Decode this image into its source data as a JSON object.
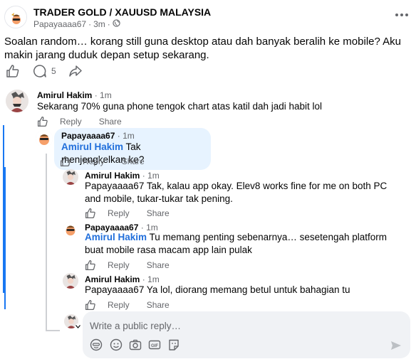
{
  "post": {
    "group_name": "TRADER GOLD / XAUUSD MALAYSIA",
    "author": "Papayaaaa67",
    "time": "3m",
    "separator": "·",
    "body": "Soalan random… korang still guna desktop atau dah banyak beralih ke mobile? Aku makin jarang duduk depan setup sekarang.",
    "comment_count": "5",
    "icons": [
      "like-icon",
      "comment-icon",
      "share-icon",
      "globe-icon",
      "more-options-icon"
    ]
  },
  "comments": [
    {
      "author": "Amirul Hakim",
      "time": "· 1m",
      "mention": "",
      "text": "Sekarang 70% guna phone tengok chart atas katil dah jadi habit lol",
      "reply_label": "Reply",
      "share_label": "Share"
    },
    {
      "author": "Papayaaaa67",
      "time": "· 1m",
      "mention": "Amirul Hakim",
      "text": "Tak menjengkelkan ke?",
      "reply_label": "Reply",
      "share_label": "Share"
    },
    {
      "author": "Amirul Hakim",
      "time": "· 1m",
      "mention": "",
      "text": "Papayaaaa67 Tak, kalau app okay. Elev8 works fine for me on both PC and mobile, tukar-tukar tak pening.",
      "reply_label": "Reply",
      "share_label": "Share"
    },
    {
      "author": "Papayaaaa67",
      "time": "· 1m",
      "mention": "Amirul Hakim",
      "text": "Tu memang penting sebenarnya… sesetengah platform buat mobile rasa macam app lain pulak",
      "reply_label": "Reply",
      "share_label": "Share"
    },
    {
      "author": "Amirul Hakim",
      "time": "· 1m",
      "mention": "",
      "text": "Papayaaaa67 Ya lol, diorang memang betul untuk bahagian tu",
      "reply_label": "Reply",
      "share_label": "Share"
    }
  ],
  "reply_box": {
    "placeholder": "Write a public reply…",
    "tools": [
      "avatar-sticker-icon",
      "emoji-icon",
      "camera-icon",
      "gif-icon",
      "sticker-icon",
      "send-icon"
    ]
  },
  "colors": {
    "mention": "#216fdb",
    "highlight_line": "#1877f2",
    "bubble": "#e7f3ff",
    "secondary_text": "#65676b"
  }
}
